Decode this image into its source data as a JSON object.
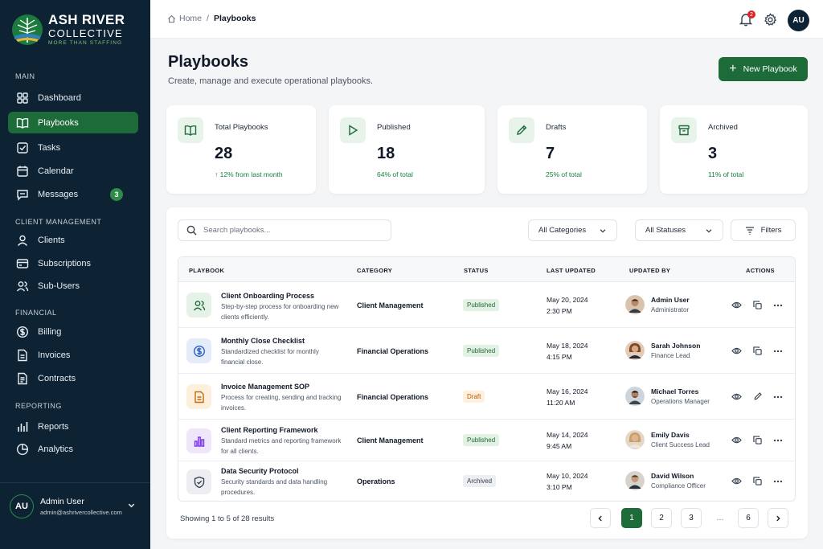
{
  "brand": {
    "line1": "ASH RIVER",
    "line2": "COLLECTIVE",
    "tagline": "MORE THAN STAFFING"
  },
  "sidebar": {
    "sections": {
      "main": "MAIN",
      "client": "CLIENT MANAGEMENT",
      "financial": "FINANCIAL",
      "reporting": "REPORTING"
    },
    "items": {
      "dashboard": "Dashboard",
      "playbooks": "Playbooks",
      "tasks": "Tasks",
      "calendar": "Calendar",
      "messages": "Messages",
      "messages_badge": "3",
      "clients": "Clients",
      "subscriptions": "Subscriptions",
      "subusers": "Sub-Users",
      "billing": "Billing",
      "invoices": "Invoices",
      "contracts": "Contracts",
      "reports": "Reports",
      "analytics": "Analytics"
    },
    "user": {
      "initials": "AU",
      "name": "Admin User",
      "email": "admin@ashrivercollective.com"
    }
  },
  "topbar": {
    "home": "Home",
    "sep": "/",
    "current": "Playbooks",
    "notif_count": "2",
    "avatar": "AU"
  },
  "header": {
    "title": "Playbooks",
    "subtitle": "Create, manage and execute operational playbooks.",
    "new_button": "New Playbook"
  },
  "stats": [
    {
      "label": "Total Playbooks",
      "value": "28",
      "note": "↑ 12% from last month"
    },
    {
      "label": "Published",
      "value": "18",
      "note": "64% of total"
    },
    {
      "label": "Drafts",
      "value": "7",
      "note": "25% of total"
    },
    {
      "label": "Archived",
      "value": "3",
      "note": "11% of total"
    }
  ],
  "toolbar": {
    "search_placeholder": "Search playbooks...",
    "category": "All Categories",
    "status": "All Statuses",
    "filters": "Filters"
  },
  "table": {
    "headers": {
      "playbook": "PLAYBOOK",
      "category": "CATEGORY",
      "status": "STATUS",
      "updated": "LAST UPDATED",
      "by": "UPDATED BY",
      "actions": "ACTIONS"
    },
    "rows": [
      {
        "name": "Client Onboarding Process",
        "desc": "Step-by-step process for onboarding new clients efficiently.",
        "category": "Client Management",
        "status": "Published",
        "date": "May 20, 2024",
        "time": "2:30 PM",
        "user": "Admin User",
        "role": "Administrator"
      },
      {
        "name": "Monthly Close Checklist",
        "desc": "Standardized checklist for monthly financial close.",
        "category": "Financial Operations",
        "status": "Published",
        "date": "May 18, 2024",
        "time": "4:15 PM",
        "user": "Sarah Johnson",
        "role": "Finance Lead"
      },
      {
        "name": "Invoice Management SOP",
        "desc": "Process for creating, sending and tracking invoices.",
        "category": "Financial Operations",
        "status": "Draft",
        "date": "May 16, 2024",
        "time": "11:20 AM",
        "user": "Michael Torres",
        "role": "Operations Manager"
      },
      {
        "name": "Client Reporting Framework",
        "desc": "Standard metrics and reporting framework for all clients.",
        "category": "Client Management",
        "status": "Published",
        "date": "May 14, 2024",
        "time": "9:45 AM",
        "user": "Emily Davis",
        "role": "Client Success Lead"
      },
      {
        "name": "Data Security Protocol",
        "desc": "Security standards and data handling procedures.",
        "category": "Operations",
        "status": "Archived",
        "date": "May 10, 2024",
        "time": "3:10 PM",
        "user": "David Wilson",
        "role": "Compliance Officer"
      }
    ]
  },
  "pagination": {
    "showing": "Showing 1 to 5 of 28 results",
    "pages": [
      "1",
      "2",
      "3",
      "…",
      "6"
    ]
  },
  "colors": {
    "primary": "#1e6b3a",
    "sidebar": "#0d2233",
    "published": "#1c6b32",
    "draft": "#b45f06"
  }
}
